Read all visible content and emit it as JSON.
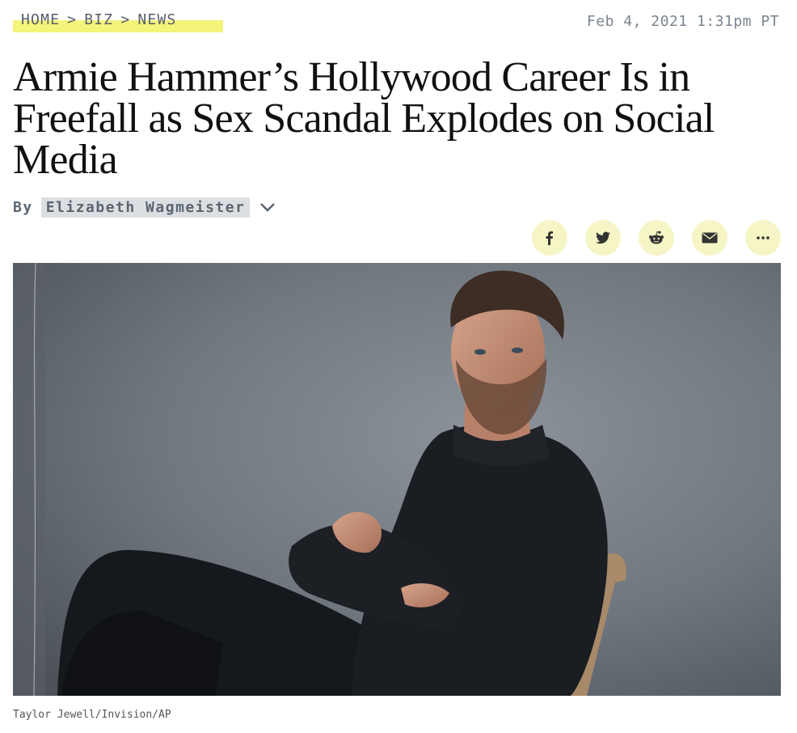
{
  "breadcrumb": {
    "home": "HOME",
    "biz": "BIZ",
    "news": "NEWS",
    "separator": ">"
  },
  "timestamp": "Feb 4, 2021 1:31pm PT",
  "headline": "Armie Hammer’s Hollywood Career Is in Freefall as Sex Scandal Explodes on Social Media",
  "byline": {
    "prefix": "By",
    "author": "Elizabeth Wagmeister"
  },
  "share": [
    {
      "name": "facebook",
      "icon": "facebook-icon"
    },
    {
      "name": "twitter",
      "icon": "twitter-icon"
    },
    {
      "name": "reddit",
      "icon": "reddit-icon"
    },
    {
      "name": "email",
      "icon": "email-icon"
    },
    {
      "name": "more",
      "icon": "more-icon"
    }
  ],
  "photo": {
    "credit": "Taylor Jewell/Invision/AP"
  },
  "colors": {
    "highlight": "#f4f37a",
    "share_bg": "#f5f5c6",
    "author_bg": "#dcdfe2"
  }
}
